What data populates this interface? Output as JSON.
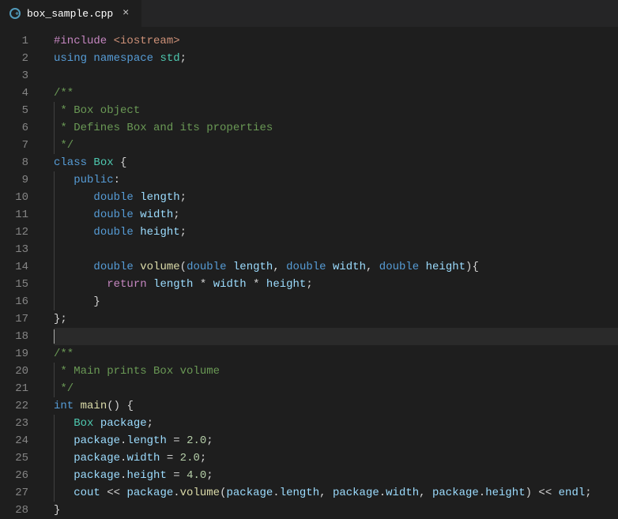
{
  "tab": {
    "file_name": "box_sample.cpp",
    "icon_name": "cpp-file-icon",
    "close": "×"
  },
  "editor": {
    "active_line": 18,
    "line_count": 28
  },
  "code": {
    "l1": {
      "a": "#include",
      "b": " ",
      "c": "<iostream>"
    },
    "l2": {
      "a": "using",
      "b": " ",
      "c": "namespace",
      "d": " ",
      "e": "std",
      "f": ";"
    },
    "l4": {
      "a": "/**"
    },
    "l5": {
      "a": " * Box object"
    },
    "l6": {
      "a": " * Defines Box and its properties"
    },
    "l7": {
      "a": " */"
    },
    "l8": {
      "a": "class",
      "b": " ",
      "c": "Box",
      "d": " {"
    },
    "l9": {
      "a": "public",
      "b": ":"
    },
    "l10": {
      "a": "double",
      "b": " ",
      "c": "length",
      "d": ";"
    },
    "l11": {
      "a": "double",
      "b": " ",
      "c": "width",
      "d": ";"
    },
    "l12": {
      "a": "double",
      "b": " ",
      "c": "height",
      "d": ";"
    },
    "l14": {
      "a": "double",
      "b": " ",
      "c": "volume",
      "d": "(",
      "e": "double",
      "f": " ",
      "g": "length",
      "h": ", ",
      "i": "double",
      "j": " ",
      "k": "width",
      "l": ", ",
      "m": "double",
      "n": " ",
      "o": "height",
      "p": "){"
    },
    "l15": {
      "a": "return",
      "b": " ",
      "c": "length",
      "d": " * ",
      "e": "width",
      "f": " * ",
      "g": "height",
      "h": ";"
    },
    "l16": {
      "a": "}"
    },
    "l17": {
      "a": "};"
    },
    "l19": {
      "a": "/**"
    },
    "l20": {
      "a": " * Main prints Box volume"
    },
    "l21": {
      "a": " */"
    },
    "l22": {
      "a": "int",
      "b": " ",
      "c": "main",
      "d": "() {"
    },
    "l23": {
      "a": "Box",
      "b": " ",
      "c": "package",
      "d": ";"
    },
    "l24": {
      "a": "package",
      "b": ".",
      "c": "length",
      "d": " = ",
      "e": "2.0",
      "f": ";"
    },
    "l25": {
      "a": "package",
      "b": ".",
      "c": "width",
      "d": " = ",
      "e": "2.0",
      "f": ";"
    },
    "l26": {
      "a": "package",
      "b": ".",
      "c": "height",
      "d": " = ",
      "e": "4.0",
      "f": ";"
    },
    "l27": {
      "a": "cout",
      "b": " << ",
      "c": "package",
      "d": ".",
      "e": "volume",
      "f": "(",
      "g": "package",
      "h": ".",
      "i": "length",
      "j": ", ",
      "k": "package",
      "l": ".",
      "m": "width",
      "n": ", ",
      "o": "package",
      "p": ".",
      "q": "height",
      "r": ") << ",
      "s": "endl",
      "t": ";"
    },
    "l28": {
      "a": "}"
    }
  }
}
